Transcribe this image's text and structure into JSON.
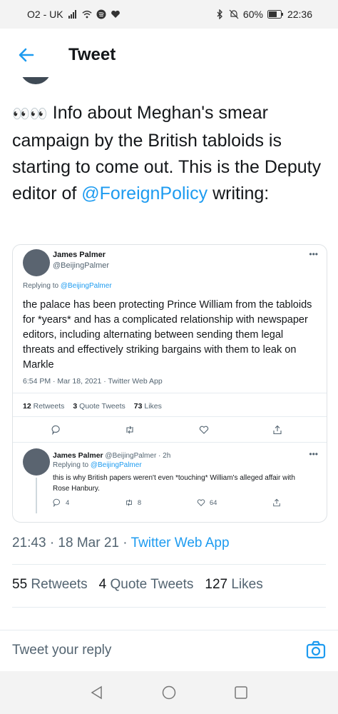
{
  "status_bar": {
    "carrier": "O2 - UK",
    "battery": "60%",
    "time": "22:36"
  },
  "header": {
    "title": "Tweet"
  },
  "tweet": {
    "emoji": "👀👀",
    "text_before": " Info about Meghan's smear campaign by the British tabloids is starting to come out.  This is the Deputy editor of ",
    "mention": "@ForeignPolicy",
    "text_after": " writing:"
  },
  "embedded": {
    "name": "James Palmer",
    "handle": "@BeijingPalmer",
    "replying_label": "Replying to ",
    "replying_handle": "@BeijingPalmer",
    "body": "the palace has been protecting Prince William from the tabloids for *years* and has a complicated relationship with newspaper editors, including alternating between sending them legal threats and effectively striking bargains with them to leak on Markle",
    "timestamp": "6:54 PM · Mar 18, 2021 · Twitter Web App",
    "stats": {
      "retweets": "12",
      "retweets_label": "Retweets",
      "quotes": "3",
      "quotes_label": "Quote Tweets",
      "likes": "73",
      "likes_label": "Likes"
    },
    "reply": {
      "name": "James Palmer",
      "handle_time": "@BeijingPalmer · 2h",
      "replying_label": "Replying to ",
      "replying_handle": "@BeijingPalmer",
      "body": "this is why British papers weren't even *touching* William's alleged affair with Rose Hanbury.",
      "replies": "4",
      "retweets": "8",
      "likes": "64"
    }
  },
  "meta": {
    "time_date": "21:43 · 18 Mar 21 · ",
    "source": "Twitter Web App"
  },
  "stats": {
    "retweets": "55",
    "retweets_label": "Retweets",
    "quotes": "4",
    "quotes_label": "Quote Tweets",
    "likes": "127",
    "likes_label": "Likes"
  },
  "reply_bar": {
    "placeholder": "Tweet your reply"
  },
  "colors": {
    "accent": "#1d9bf0",
    "text": "#14171a",
    "muted": "#536471"
  }
}
